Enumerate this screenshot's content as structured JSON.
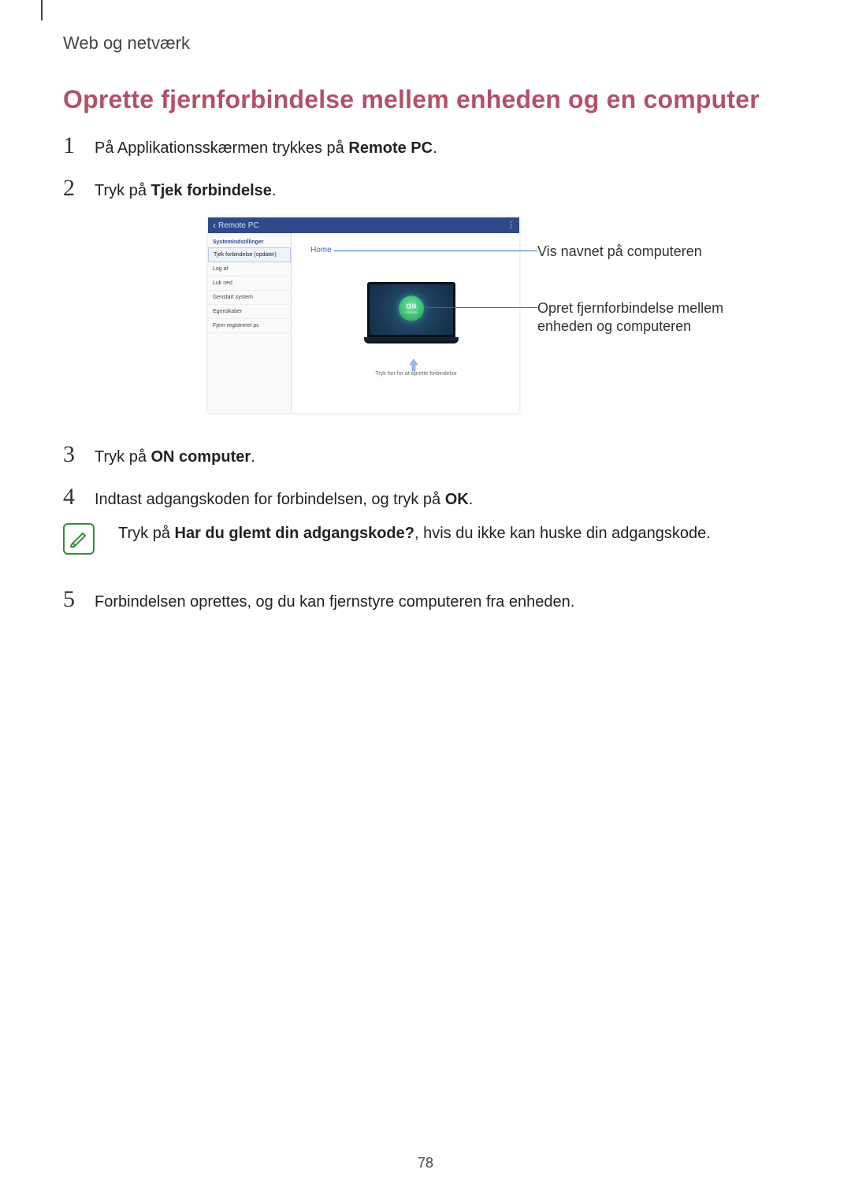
{
  "section_label": "Web og netværk",
  "page_title": "Oprette fjernforbindelse mellem enheden og en computer",
  "steps": {
    "s1_pre": "På Applikationsskærmen trykkes på ",
    "s1_bold": "Remote PC",
    "s1_post": ".",
    "s2_pre": "Tryk på ",
    "s2_bold": "Tjek forbindelse",
    "s2_post": ".",
    "s3_pre": "Tryk på ",
    "s3_bold": "ON computer",
    "s3_post": ".",
    "s4_pre": "Indtast adgangskoden for forbindelsen, og tryk på ",
    "s4_bold": "OK",
    "s4_post": ".",
    "s5": "Forbindelsen oprettes, og du kan fjernstyre computeren fra enheden."
  },
  "note": {
    "pre": "Tryk på ",
    "bold": "Har du glemt din adgangskode?",
    "post": ", hvis du ikke kan huske din adgangskode."
  },
  "app": {
    "header_title": "Remote PC",
    "sidebar_heading": "Systemindstillinger",
    "sidebar_items": [
      "Tjek forbindelse (opdater)",
      "Log af",
      "Luk ned",
      "Genstart system",
      "Egenskaber",
      "Fjern registreret pc"
    ],
    "home_label": "Home",
    "power_label": "ON",
    "power_sub": "computer",
    "connect_text": "Tryk her for at oprette forbindelse"
  },
  "callouts": {
    "home": "Vis navnet på computeren",
    "on": "Opret fjernforbindelse mellem enheden og computeren"
  },
  "page_number": "78"
}
